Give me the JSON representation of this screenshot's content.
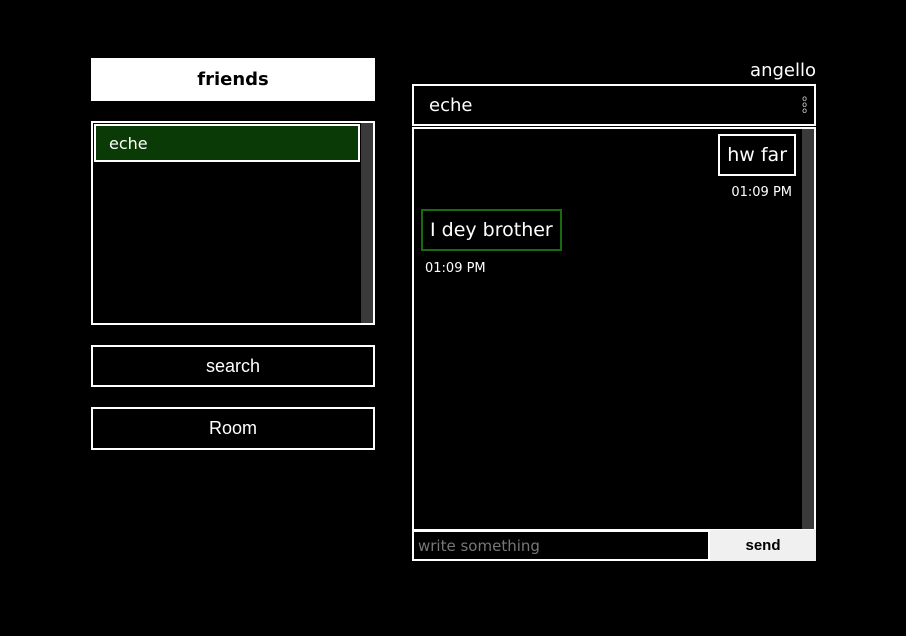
{
  "sidebar": {
    "title": "friends",
    "friends": [
      {
        "name": "eche",
        "selected": true
      }
    ],
    "search_label": "search",
    "room_label": "Room"
  },
  "user": {
    "name": "angello"
  },
  "chat": {
    "contact": "eche",
    "menu_icon": "vertical-dots-icon",
    "messages": [
      {
        "text": "hw far",
        "time": "01:09 PM",
        "direction": "outgoing"
      },
      {
        "text": "I dey brother",
        "time": "01:09 PM",
        "direction": "incoming"
      }
    ],
    "input_placeholder": "write something",
    "input_value": "",
    "send_label": "send"
  },
  "colors": {
    "selected_bg": "#0a3a05",
    "incoming_border": "#1a6a10",
    "scrollbar": "#3a3a3a"
  }
}
